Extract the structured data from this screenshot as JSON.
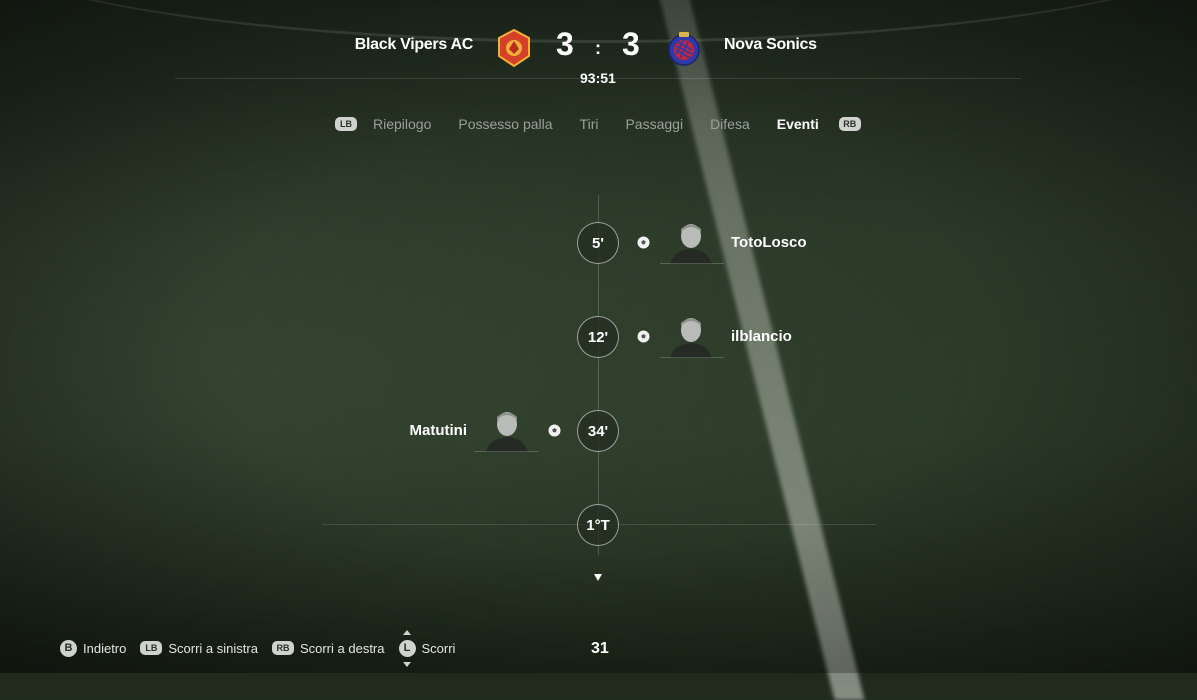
{
  "header": {
    "home": {
      "name": "Black Vipers AC",
      "score": "3",
      "crest_color": "#d4402a"
    },
    "away": {
      "name": "Nova Sonics",
      "score": "3",
      "crest_color": "#2e3aa8"
    },
    "separator": ":",
    "clock": "93:51"
  },
  "tabs": {
    "left_button": "LB",
    "right_button": "RB",
    "items": [
      "Riepilogo",
      "Possesso palla",
      "Tiri",
      "Passaggi",
      "Difesa",
      "Eventi"
    ],
    "active": "Eventi"
  },
  "timeline": {
    "events": [
      {
        "minute": "5'",
        "player": "TotoLosco",
        "side": "away",
        "type": "goal",
        "icon": "ball-icon"
      },
      {
        "minute": "12'",
        "player": "ilblancio",
        "side": "away",
        "type": "goal",
        "icon": "ball-icon"
      },
      {
        "minute": "34'",
        "player": "Matutini",
        "side": "home",
        "type": "goal",
        "icon": "ball-icon"
      }
    ],
    "period_marker": "1°T"
  },
  "footer": {
    "back": {
      "button": "B",
      "label": "Indietro"
    },
    "scroll_left": {
      "button": "LB",
      "label": "Scorri a sinistra"
    },
    "scroll_right": {
      "button": "RB",
      "label": "Scorri a destra"
    },
    "scroll": {
      "button": "L",
      "label": "Scorri"
    },
    "page_number": "31"
  }
}
